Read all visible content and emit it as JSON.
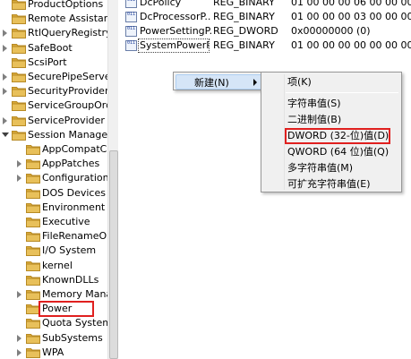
{
  "tree": {
    "items": [
      {
        "label": "ProductOptions",
        "has_children": false
      },
      {
        "label": "Remote Assistance",
        "has_children": false
      },
      {
        "label": "RtlQueryRegistryConfig",
        "has_children": true
      },
      {
        "label": "SafeBoot",
        "has_children": true
      },
      {
        "label": "ScsiPort",
        "has_children": false
      },
      {
        "label": "SecurePipeServers",
        "has_children": true
      },
      {
        "label": "SecurityProviders",
        "has_children": true
      },
      {
        "label": "ServiceGroupOrder",
        "has_children": false
      },
      {
        "label": "ServiceProvider",
        "has_children": true
      },
      {
        "label": "Session Manager",
        "has_children": true,
        "expanded": true
      },
      {
        "label": "AppCompatCache",
        "has_children": false,
        "indent": 1
      },
      {
        "label": "AppPatches",
        "has_children": true,
        "indent": 1
      },
      {
        "label": "Configuration Manager",
        "has_children": true,
        "indent": 1
      },
      {
        "label": "DOS Devices",
        "has_children": false,
        "indent": 1
      },
      {
        "label": "Environment",
        "has_children": false,
        "indent": 1
      },
      {
        "label": "Executive",
        "has_children": false,
        "indent": 1
      },
      {
        "label": "FileRenameOperations",
        "has_children": false,
        "indent": 1
      },
      {
        "label": "I/O System",
        "has_children": false,
        "indent": 1
      },
      {
        "label": "kernel",
        "has_children": false,
        "indent": 1
      },
      {
        "label": "KnownDLLs",
        "has_children": false,
        "indent": 1
      },
      {
        "label": "Memory Management",
        "has_children": true,
        "indent": 1
      },
      {
        "label": "Power",
        "has_children": false,
        "indent": 1,
        "highlighted": true
      },
      {
        "label": "Quota System",
        "has_children": false,
        "indent": 1
      },
      {
        "label": "SubSystems",
        "has_children": true,
        "indent": 1
      },
      {
        "label": "WPA",
        "has_children": true,
        "indent": 1
      }
    ]
  },
  "values": {
    "rows": [
      {
        "name": "DcPolicy",
        "type": "REG_BINARY",
        "data": "01 00 00 00 06 00 00 00 0"
      },
      {
        "name": "DcProcessorP...",
        "type": "REG_BINARY",
        "data": "01 00 00 00 03 00 00 00 0"
      },
      {
        "name": "PowerSettingP...",
        "type": "REG_DWORD",
        "data": "0x00000000 (0)"
      },
      {
        "name": "SystemPowerP...",
        "type": "REG_BINARY",
        "data": "01 00 00 00 00 00 00 00 0"
      }
    ],
    "icon_text": "011"
  },
  "context_menu": {
    "new_label": "新建(N)"
  },
  "submenu": {
    "items": [
      {
        "label": "项(K)"
      },
      {
        "label": "字符串值(S)"
      },
      {
        "label": "二进制值(B)"
      },
      {
        "label": "DWORD (32-位)值(D)",
        "highlighted": true
      },
      {
        "label": "QWORD (64 位)值(Q)"
      },
      {
        "label": "多字符串值(M)"
      },
      {
        "label": "可扩充字符串值(E)"
      }
    ]
  },
  "colors": {
    "highlight_box": "#e0201f",
    "menu_hover": "#d5e5f7",
    "folder": "#e8c05a"
  }
}
